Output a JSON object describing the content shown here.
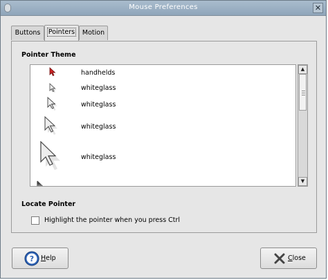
{
  "window": {
    "title": "Mouse Preferences",
    "close_glyph": "✕"
  },
  "tabs": [
    {
      "label": "Buttons",
      "active": false
    },
    {
      "label": "Pointers",
      "active": true
    },
    {
      "label": "Motion",
      "active": false
    }
  ],
  "pointer_theme": {
    "heading": "Pointer Theme",
    "themes": [
      {
        "name": "handhelds",
        "icon": "red-arrow-cursor-icon"
      },
      {
        "name": "whiteglass",
        "icon": "small-arrow-cursor-icon"
      },
      {
        "name": "whiteglass",
        "icon": "medium-arrow-cursor-icon"
      },
      {
        "name": "whiteglass",
        "icon": "large-arrow-cursor-icon"
      },
      {
        "name": "whiteglass",
        "icon": "xlarge-arrow-cursor-icon"
      }
    ]
  },
  "locate_pointer": {
    "heading": "Locate Pointer",
    "checkbox_label": "Highlight the pointer when you press Ctrl",
    "checked": false
  },
  "buttons": {
    "help_mnemonic": "H",
    "help_rest": "elp",
    "close_mnemonic": "C",
    "close_rest": "lose"
  },
  "colors": {
    "titlebar": "#9aaec1",
    "cursor_red": "#cc2222"
  }
}
